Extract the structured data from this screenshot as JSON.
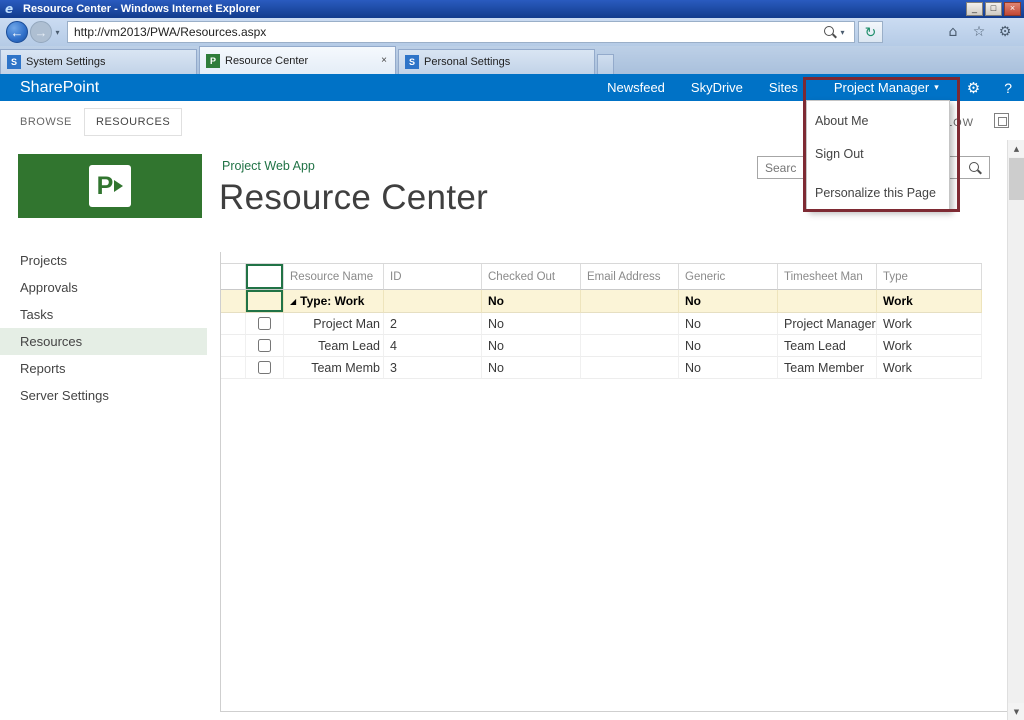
{
  "window": {
    "title": "Resource Center - Windows Internet Explorer",
    "url": "http://vm2013/PWA/Resources.aspx"
  },
  "icons": {
    "ie_logo": "e",
    "minimize": "_",
    "maximize": "□",
    "close": "×",
    "back_arrow": "←",
    "forward_arrow": "→",
    "dropdown_small": "▾",
    "refresh": "↻",
    "home": "⌂",
    "star": "☆",
    "gear": "⚙",
    "help": "?",
    "tab_letter": "S",
    "tab_close": "×",
    "user_dropdown_arrow": "▾",
    "project_letter": "P",
    "group_expand": "◢",
    "scroll_up": "▲",
    "scroll_down": "▼"
  },
  "browser_tabs": [
    {
      "label": "System Settings"
    },
    {
      "label": "Resource Center"
    },
    {
      "label": "Personal Settings"
    }
  ],
  "suite_bar": {
    "brand": "SharePoint",
    "newsfeed": "Newsfeed",
    "skydrive": "SkyDrive",
    "sites": "Sites",
    "user_menu": "Project Manager"
  },
  "user_dropdown": {
    "about_me": "About Me",
    "sign_out": "Sign Out",
    "personalize": "Personalize this Page"
  },
  "ribbon": {
    "browse": "BROWSE",
    "resources": "RESOURCES",
    "follow_partial": "LOW"
  },
  "page": {
    "app_name": "Project Web App",
    "title": "Resource Center",
    "search_text": "Searc"
  },
  "sidebar": {
    "items": [
      {
        "label": "Projects"
      },
      {
        "label": "Approvals"
      },
      {
        "label": "Tasks"
      },
      {
        "label": "Resources"
      },
      {
        "label": "Reports"
      },
      {
        "label": "Server Settings"
      }
    ]
  },
  "grid": {
    "columns": [
      "Resource Name",
      "ID",
      "Checked Out",
      "Email Address",
      "Generic",
      "Timesheet Man",
      "Type"
    ],
    "group_row": {
      "label": "Type: Work",
      "checked_out": "No",
      "generic": "No",
      "type": "Work"
    },
    "rows": [
      {
        "name": "Project Man",
        "id": "2",
        "checked_out": "No",
        "email": "",
        "generic": "No",
        "timesheet_manager": "Project Manager",
        "type": "Work"
      },
      {
        "name": "Team Lead",
        "id": "4",
        "checked_out": "No",
        "email": "",
        "generic": "No",
        "timesheet_manager": "Team Lead",
        "type": "Work"
      },
      {
        "name": "Team Memb",
        "id": "3",
        "checked_out": "No",
        "email": "",
        "generic": "No",
        "timesheet_manager": "Team Member",
        "type": "Work"
      }
    ]
  }
}
